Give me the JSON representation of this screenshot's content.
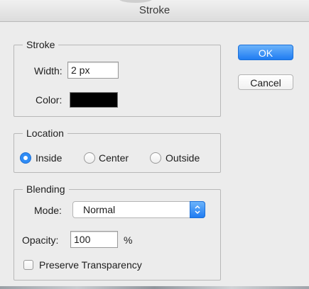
{
  "window": {
    "title": "Stroke"
  },
  "stroke": {
    "legend": "Stroke",
    "width_label": "Width:",
    "width_value": "2 px",
    "color_label": "Color:",
    "color_value": "#000000"
  },
  "location": {
    "legend": "Location",
    "options": [
      "Inside",
      "Center",
      "Outside"
    ],
    "selected": "Inside"
  },
  "blending": {
    "legend": "Blending",
    "mode_label": "Mode:",
    "mode_value": "Normal",
    "opacity_label": "Opacity:",
    "opacity_value": "100",
    "opacity_unit": "%",
    "preserve_label": "Preserve Transparency",
    "preserve_checked": false
  },
  "buttons": {
    "ok": "OK",
    "cancel": "Cancel"
  },
  "colors": {
    "accent": "#1f7cf2",
    "background": "#ececec"
  }
}
